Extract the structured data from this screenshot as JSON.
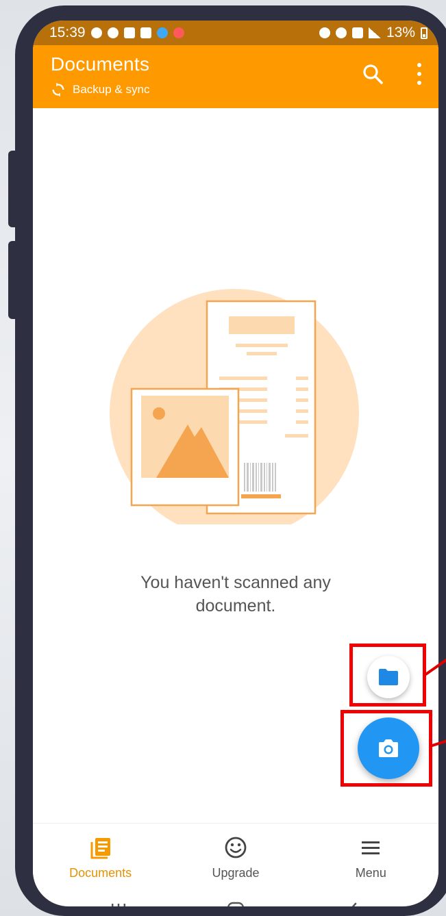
{
  "status_bar": {
    "time": "15:39",
    "battery": "13%"
  },
  "app_bar": {
    "title": "Documents",
    "subtitle": "Backup & sync",
    "search_icon": "search-icon",
    "more_icon": "more-vert-icon"
  },
  "empty_state": {
    "message": "You haven't scanned any document."
  },
  "fabs": {
    "import_icon": "folder-icon",
    "scan_icon": "camera-icon"
  },
  "bottom_nav": {
    "items": [
      {
        "label": "Documents",
        "icon": "documents-icon",
        "active": true
      },
      {
        "label": "Upgrade",
        "icon": "smiley-icon",
        "active": false
      },
      {
        "label": "Menu",
        "icon": "hamburger-icon",
        "active": false
      }
    ]
  },
  "colors": {
    "app_bar": "#ff9900",
    "status_bar": "#b8700b",
    "fab_primary": "#2196f3",
    "active_nav": "#e69200",
    "highlight": "#f00000"
  }
}
